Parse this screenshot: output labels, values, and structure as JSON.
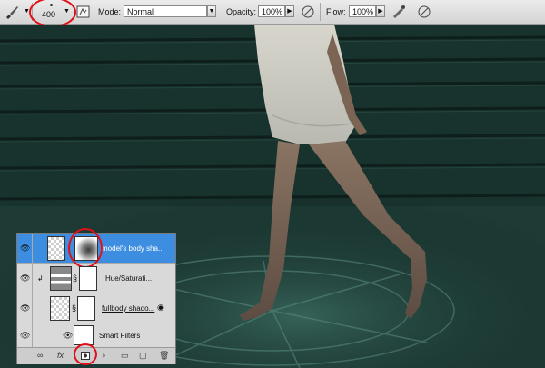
{
  "toolbar": {
    "brush_size": "400",
    "mode_label": "Mode:",
    "mode_value": "Normal",
    "opacity_label": "Opacity:",
    "opacity_value": "100%",
    "flow_label": "Flow:",
    "flow_value": "100%"
  },
  "layers": [
    {
      "name": "model's body sha...",
      "selected": true
    },
    {
      "name": "Hue/Saturati..."
    },
    {
      "name": "fullbody shado..."
    },
    {
      "name": "Smart Filters"
    }
  ],
  "colors": {
    "highlight_ring": "#e0101a",
    "selected_row": "#3d8ee0",
    "scene_tint": "#1e3e38"
  },
  "icons": [
    "brush-icon",
    "airbrush-icon",
    "tablet-pressure-icon",
    "eye-icon",
    "link-icon",
    "fx-icon",
    "mask-icon",
    "adjustment-icon",
    "group-icon",
    "new-layer-icon",
    "trash-icon"
  ]
}
